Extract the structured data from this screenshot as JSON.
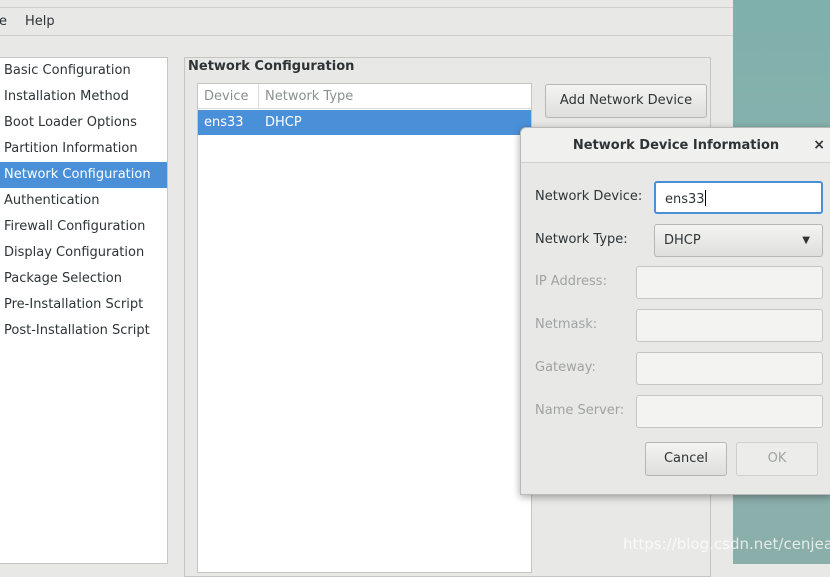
{
  "menubar": {
    "items": [
      "e",
      "Help"
    ]
  },
  "sidebar": {
    "items": [
      "Basic Configuration",
      "Installation Method",
      "Boot Loader Options",
      "Partition Information",
      "Network Configuration",
      "Authentication",
      "Firewall Configuration",
      "Display Configuration",
      "Package Selection",
      "Pre-Installation Script",
      "Post-Installation Script"
    ],
    "selected": "Network Configuration"
  },
  "network": {
    "title": "Network Configuration",
    "columns": [
      "Device",
      "Network Type"
    ],
    "rows": [
      {
        "device": "ens33",
        "type": "DHCP"
      }
    ],
    "add_button": "Add Network Device"
  },
  "dialog": {
    "title": "Network Device Information",
    "close": "×",
    "device_label": "Network Device:",
    "device_value": "ens33",
    "type_label": "Network Type:",
    "type_value": "DHCP",
    "ip_label": "IP Address:",
    "netmask_label": "Netmask:",
    "gateway_label": "Gateway:",
    "ns_label": "Name Server:",
    "cancel": "Cancel",
    "ok": "OK"
  },
  "watermark": "https://blog.csdn.net/cenjeal",
  "colors": {
    "accent": "#4a90d9"
  }
}
